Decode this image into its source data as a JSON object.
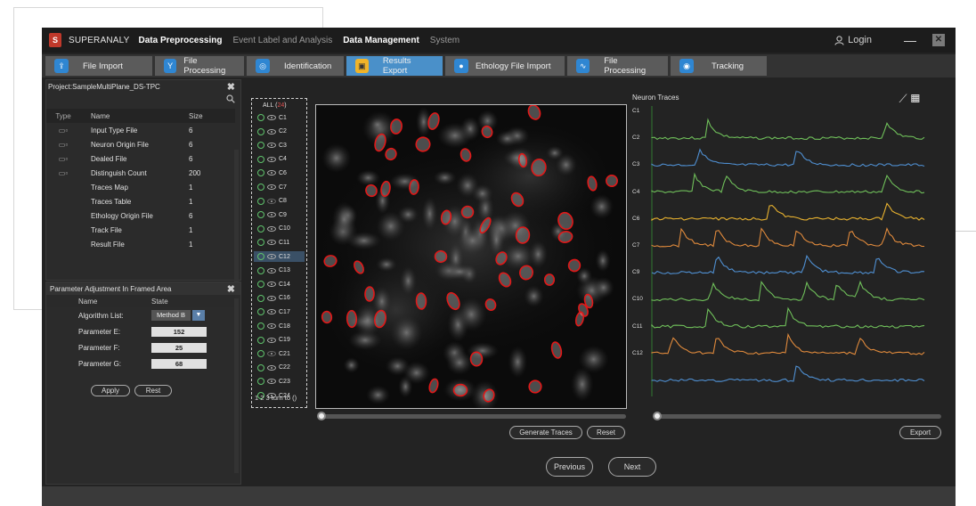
{
  "app": {
    "brand": "SUPERANALY",
    "menu": [
      "Data Preprocessing",
      "Event Label and Analysis",
      "Data Management",
      "System"
    ],
    "login": "Login",
    "window_min": "—",
    "window_close": "✕"
  },
  "toolbar": [
    {
      "label": "File Import",
      "icon": "import-icon",
      "glyph": "⇪"
    },
    {
      "label": "File Processing",
      "icon": "filter-icon",
      "glyph": "Y"
    },
    {
      "label": "Identification",
      "icon": "target-icon",
      "glyph": "◎"
    },
    {
      "label": "Results Export",
      "icon": "export-icon",
      "glyph": "▣"
    },
    {
      "label": "Ethology File Import",
      "icon": "camera-icon",
      "glyph": "●"
    },
    {
      "label": "File Processing",
      "icon": "waveform-icon",
      "glyph": "∿"
    },
    {
      "label": "Tracking",
      "icon": "tracking-icon",
      "glyph": "◉"
    }
  ],
  "project": {
    "title": "Project:SampleMultiPlane_DS-TPC",
    "columns": [
      "Type",
      "Name",
      "Size"
    ],
    "rows": [
      {
        "name": "Input Type File",
        "size": "6"
      },
      {
        "name": "Neuron Origin File",
        "size": "6"
      },
      {
        "name": "Dealed File",
        "size": "6"
      },
      {
        "name": "Distinguish Count",
        "size": "200"
      },
      {
        "name": "Traces Map",
        "size": "1"
      },
      {
        "name": "Traces Table",
        "size": "1"
      },
      {
        "name": "Ethology Origin File",
        "size": "6"
      },
      {
        "name": "Track File",
        "size": "1"
      },
      {
        "name": "Result File",
        "size": "1"
      }
    ],
    "add_label": "+"
  },
  "params": {
    "title": "Parameter Adjustment In Framed Area",
    "columns": [
      "Name",
      "State"
    ],
    "algorithm_label": "Algorithm List:",
    "algorithm_value": "Method B",
    "rows": [
      {
        "name": "Parameter E:",
        "value": "152"
      },
      {
        "name": "Parameter F:",
        "value": "25"
      },
      {
        "name": "Parameter G:",
        "value": "68"
      }
    ],
    "apply": "Apply",
    "reset": "Rest"
  },
  "neurons": {
    "all_label": "ALL (",
    "all_count": "24",
    "all_close": ")",
    "items": [
      "C1",
      "C2",
      "C3",
      "C4",
      "C6",
      "C7",
      "C8",
      "C9",
      "C10",
      "C11",
      "C12",
      "C13",
      "C14",
      "C16",
      "C17",
      "C18",
      "C19",
      "C21",
      "C22",
      "C23",
      "C24"
    ],
    "selected": "C12",
    "hidden": [
      "C8",
      "C21"
    ],
    "pager_prefix": "1 2 3 turn to (",
    "pager_value": "",
    "pager_suffix": ")"
  },
  "image_panel": {
    "generate": "Generate Traces",
    "reset": "Reset"
  },
  "traces": {
    "title": "Neuron Traces",
    "labels": [
      "C1",
      "C2",
      "C3",
      "C4",
      "C6",
      "C7",
      "C9",
      "C10",
      "C11",
      "C12"
    ],
    "colors": [
      "#6fbf5a",
      "#4f8fd1",
      "#6fbf5a",
      "#e8b22f",
      "#e08a3c",
      "#4f8fd1",
      "#6fbf5a",
      "#6fbf5a",
      "#e08a3c",
      "#4f8fd1"
    ],
    "export": "Export"
  },
  "nav": {
    "previous": "Previous",
    "next": "Next"
  }
}
